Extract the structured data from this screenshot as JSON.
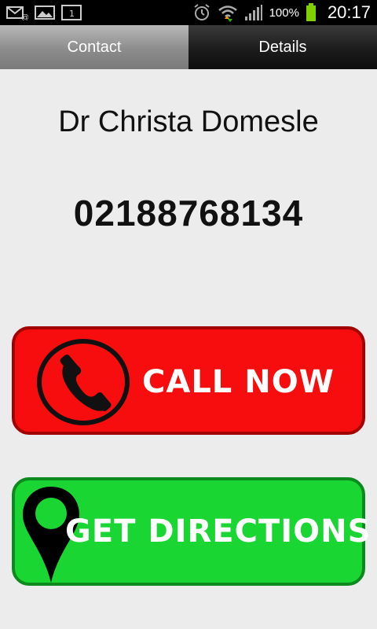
{
  "statusbar": {
    "battery_percent": "100%",
    "time": "20:17",
    "icons": [
      "mail-icon",
      "image-icon",
      "calendar-icon",
      "alarm-icon",
      "wifi-icon",
      "signal-icon",
      "battery-icon"
    ],
    "calendar_day": "1"
  },
  "tabs": [
    {
      "label": "Contact",
      "active": true
    },
    {
      "label": "Details",
      "active": false
    }
  ],
  "contact": {
    "name": "Dr Christa Domesle",
    "phone": "02188768134"
  },
  "buttons": {
    "call_label": "CALL NOW",
    "directions_label": "GET DIRECTIONS"
  },
  "colors": {
    "call": "#f70d0d",
    "directions": "#19d633",
    "background": "#ececec"
  }
}
